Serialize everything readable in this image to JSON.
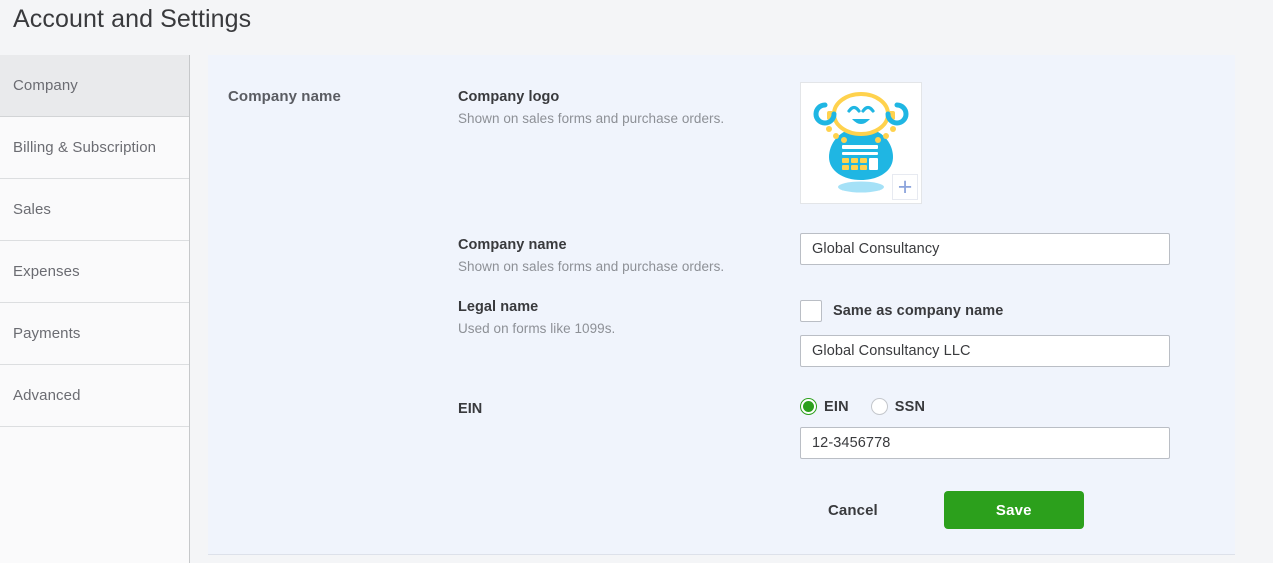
{
  "header": {
    "title": "Account and Settings"
  },
  "sidebar": {
    "items": [
      {
        "label": "Company",
        "active": true
      },
      {
        "label": "Billing & Subscription",
        "active": false
      },
      {
        "label": "Sales",
        "active": false
      },
      {
        "label": "Expenses",
        "active": false
      },
      {
        "label": "Payments",
        "active": false
      },
      {
        "label": "Advanced",
        "active": false
      }
    ]
  },
  "content": {
    "section_title": "Company name",
    "fields": {
      "logo": {
        "label": "Company logo",
        "hint": "Shown on sales forms and purchase orders.",
        "add_icon": "+"
      },
      "company_name": {
        "label": "Company name",
        "hint": "Shown on sales forms and purchase orders.",
        "value": "Global Consultancy",
        "placeholder": ""
      },
      "legal_name": {
        "label": "Legal name",
        "hint": "Used on forms like 1099s.",
        "checkbox_label": "Same as company name",
        "checkbox_checked": false,
        "value": "Global Consultancy LLC",
        "placeholder": ""
      },
      "ein": {
        "label": "EIN",
        "option_ein": "EIN",
        "option_ssn": "SSN",
        "selected": "EIN",
        "value": "12-3456778",
        "placeholder": ""
      }
    },
    "actions": {
      "cancel_label": "Cancel",
      "save_label": "Save"
    }
  },
  "colors": {
    "brand_green": "#2CA01C",
    "panel_bg": "#F0F4FC",
    "page_bg": "#F4F5F7",
    "text_dark": "#393A3D",
    "text_muted": "#8D9096"
  }
}
